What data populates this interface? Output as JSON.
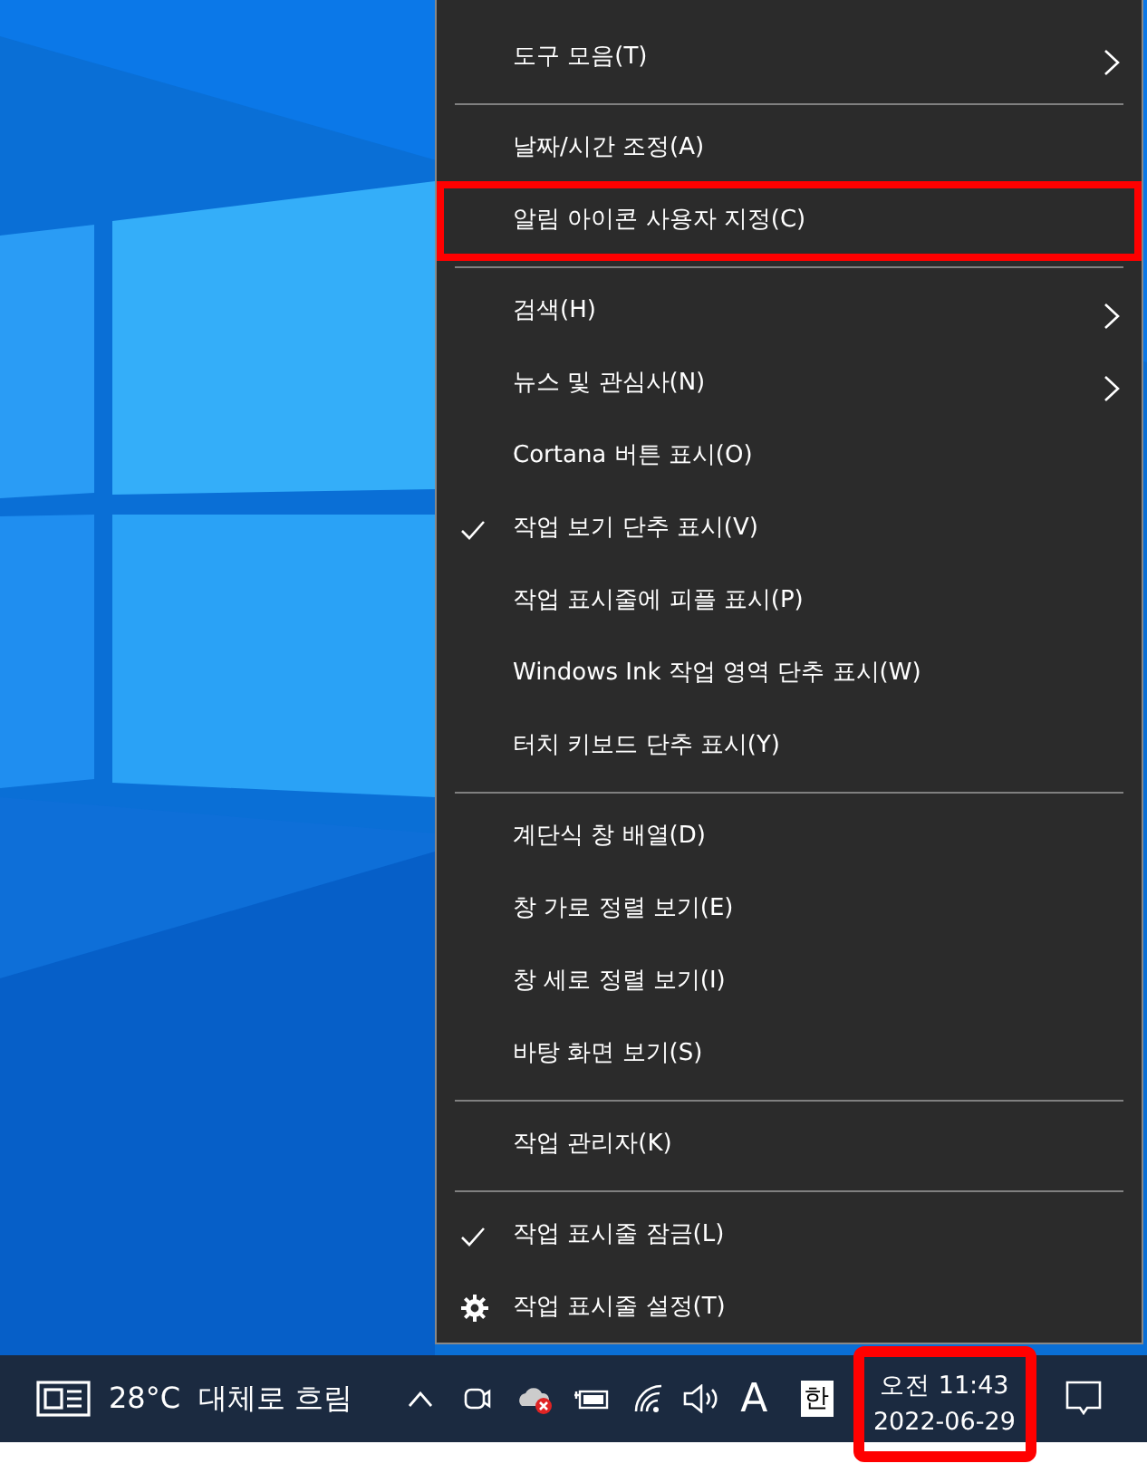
{
  "context_menu": [
    {
      "kind": "item",
      "label": "도구 모음(T)",
      "checked": false,
      "submenu": true,
      "highlighted": false
    },
    {
      "kind": "separator"
    },
    {
      "kind": "item",
      "label": "날짜/시간 조정(A)",
      "checked": false,
      "submenu": false,
      "highlighted": false
    },
    {
      "kind": "item",
      "label": "알림 아이콘 사용자 지정(C)",
      "checked": false,
      "submenu": false,
      "highlighted": true
    },
    {
      "kind": "separator"
    },
    {
      "kind": "item",
      "label": "검색(H)",
      "checked": false,
      "submenu": true,
      "highlighted": false
    },
    {
      "kind": "item",
      "label": "뉴스 및 관심사(N)",
      "checked": false,
      "submenu": true,
      "highlighted": false
    },
    {
      "kind": "item",
      "label": "Cortana 버튼 표시(O)",
      "checked": false,
      "submenu": false,
      "highlighted": false
    },
    {
      "kind": "item",
      "label": "작업 보기 단추 표시(V)",
      "checked": true,
      "submenu": false,
      "highlighted": false
    },
    {
      "kind": "item",
      "label": "작업 표시줄에 피플 표시(P)",
      "checked": false,
      "submenu": false,
      "highlighted": false
    },
    {
      "kind": "item",
      "label": "Windows Ink 작업 영역 단추 표시(W)",
      "checked": false,
      "submenu": false,
      "highlighted": false
    },
    {
      "kind": "item",
      "label": "터치 키보드 단추 표시(Y)",
      "checked": false,
      "submenu": false,
      "highlighted": false
    },
    {
      "kind": "separator"
    },
    {
      "kind": "item",
      "label": "계단식 창 배열(D)",
      "checked": false,
      "submenu": false,
      "highlighted": false
    },
    {
      "kind": "item",
      "label": "창 가로 정렬 보기(E)",
      "checked": false,
      "submenu": false,
      "highlighted": false
    },
    {
      "kind": "item",
      "label": "창 세로 정렬 보기(I)",
      "checked": false,
      "submenu": false,
      "highlighted": false
    },
    {
      "kind": "item",
      "label": "바탕 화면 보기(S)",
      "checked": false,
      "submenu": false,
      "highlighted": false
    },
    {
      "kind": "separator"
    },
    {
      "kind": "item",
      "label": "작업 관리자(K)",
      "checked": false,
      "submenu": false,
      "highlighted": false
    },
    {
      "kind": "separator"
    },
    {
      "kind": "item",
      "label": "작업 표시줄 잠금(L)",
      "checked": true,
      "submenu": false,
      "highlighted": false
    },
    {
      "kind": "settings",
      "label": "작업 표시줄 설정(T)",
      "checked": false,
      "submenu": false,
      "highlighted": false
    }
  ],
  "taskbar": {
    "weather": {
      "temperature": "28°C",
      "condition": "대체로 흐림"
    },
    "ime_mode": "A",
    "ime_language": "한",
    "clock": {
      "time": "오전 11:43",
      "date": "2022-06-29",
      "highlighted": true
    }
  }
}
